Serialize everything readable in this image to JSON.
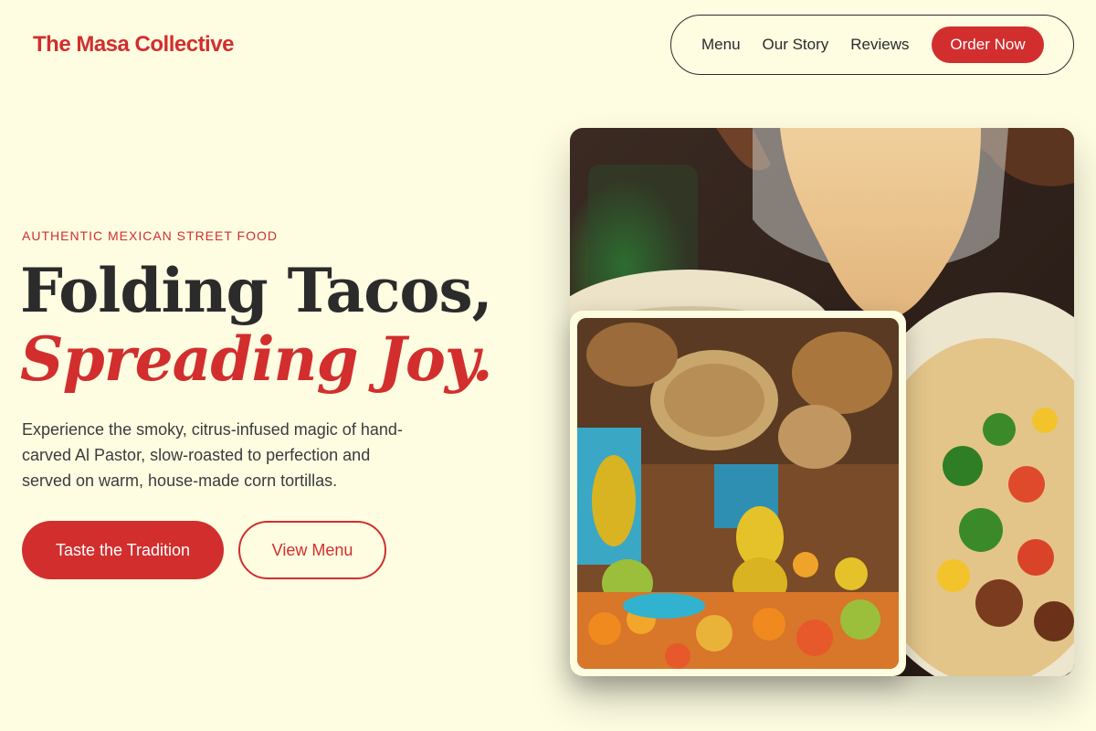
{
  "brand": {
    "name": "The Masa Collective"
  },
  "nav": {
    "links": [
      "Menu",
      "Our Story",
      "Reviews"
    ],
    "cta": "Order Now"
  },
  "hero": {
    "eyebrow": "AUTHENTIC MEXICAN STREET FOOD",
    "title_line1": "Folding Tacos,",
    "title_line2": "Spreading Joy.",
    "description": "Experience the smoky, citrus-infused magic of hand-carved Al Pastor, slow-roasted to perfection and served on warm, house-made corn tortillas.",
    "primary_button": "Taste the Tradition",
    "secondary_button": "View Menu"
  },
  "colors": {
    "background": "#fefde2",
    "accent": "#d22e2e",
    "text": "#2b2b2b"
  }
}
